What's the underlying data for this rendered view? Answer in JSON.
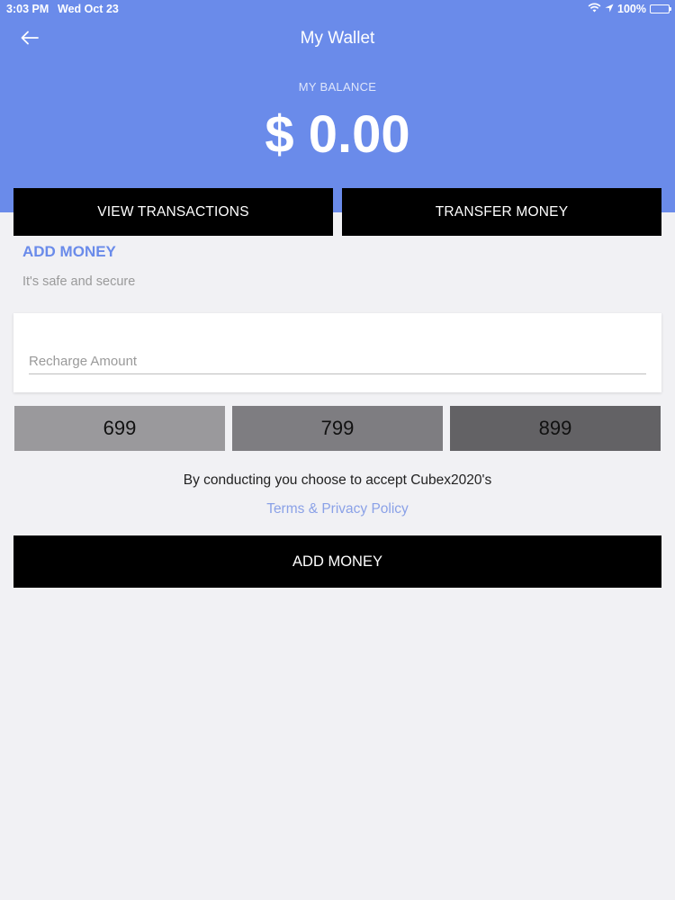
{
  "status_bar": {
    "time": "3:03 PM",
    "date": "Wed Oct 23",
    "battery": "100%",
    "icons": [
      "wifi-icon",
      "location-arrow-icon",
      "battery-icon"
    ]
  },
  "header": {
    "title": "My Wallet",
    "back_icon": "back-arrow-icon",
    "balance_label": "MY BALANCE",
    "balance_value": "$ 0.00"
  },
  "actions": {
    "view_transactions": "VIEW TRANSACTIONS",
    "transfer_money": "TRANSFER MONEY"
  },
  "add_money": {
    "heading": "ADD MONEY",
    "subtitle": "It's safe and secure",
    "input_placeholder": "Recharge Amount",
    "input_value": "",
    "presets": [
      "699",
      "799",
      "899"
    ],
    "terms_text": "By conducting you choose to accept Cubex2020's",
    "terms_link": "Terms & Privacy Policy",
    "submit_label": "ADD MONEY"
  },
  "colors": {
    "header_bg": "#6a8bea",
    "accent": "#6a8bea",
    "link": "#8aa1e7",
    "button_bg": "#000000",
    "page_bg": "#f1f1f4"
  }
}
